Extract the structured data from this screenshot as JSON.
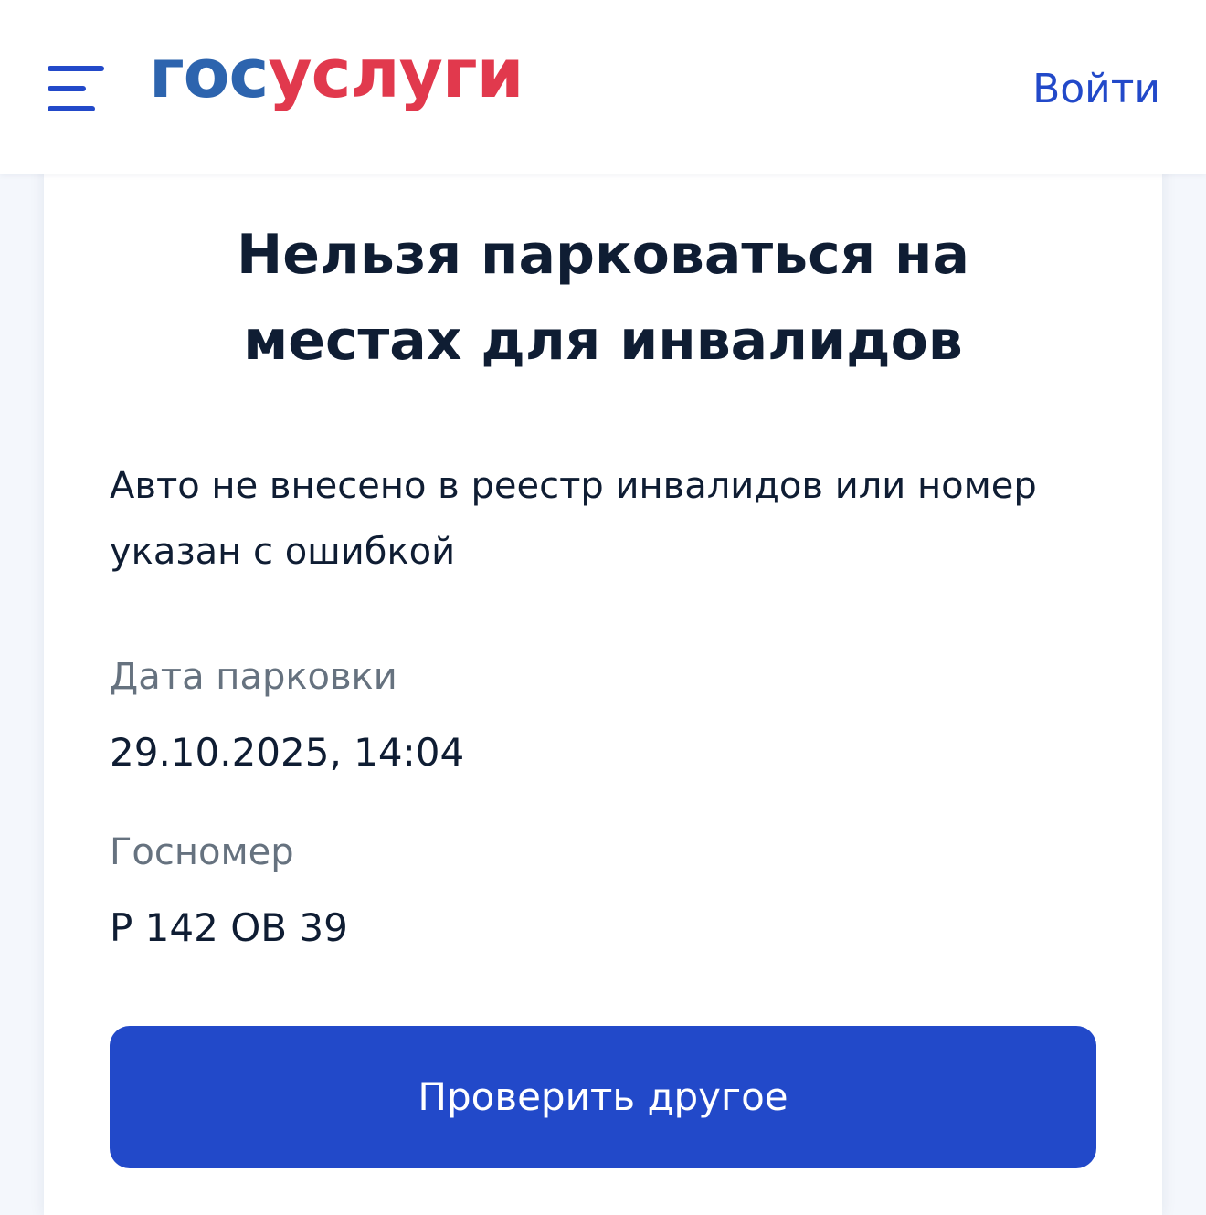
{
  "header": {
    "logo_part1": "гос",
    "logo_part2": "услуги",
    "login_label": "Войти"
  },
  "result": {
    "title": "Нельзя парковаться на местах для инвалидов",
    "description": "Авто не внесено в реестр инвалидов или номер указан с ошибкой",
    "fields": [
      {
        "label": "Дата парковки",
        "value": "29.10.2025, 14:04"
      },
      {
        "label": "Госномер",
        "value": "Р 142 ОВ 39"
      }
    ],
    "button_label": "Проверить другое"
  },
  "colors": {
    "primary": "#2249c9",
    "logo_blue": "#2d64ae",
    "logo_red": "#e1394d",
    "text": "#0f1d33",
    "muted_text": "#66727f",
    "page_background": "#f4f7fc"
  },
  "icons": {
    "menu": "hamburger-menu-icon"
  }
}
